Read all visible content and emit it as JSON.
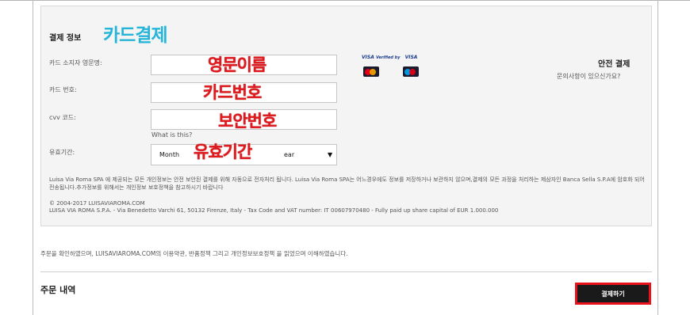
{
  "payment": {
    "section_title": "결제 정보",
    "overlay_title": "카드결제",
    "cardholder_label": "카드 소지자 영문명:",
    "cardholder_overlay": "영문이름",
    "card_number_label": "카드 번호:",
    "card_number_overlay": "카드번호",
    "cvv_label": "cvv 코드:",
    "cvv_overlay": "보안번호",
    "cvv_hint": "What is this?",
    "expiry_label": "유효기간:",
    "expiry_month": "Month",
    "expiry_year": "ear",
    "expiry_overlay": "유효기간",
    "visa_label": "VISA",
    "visa_verified": "Verified by",
    "secure_title": "안전 결제",
    "secure_sub": "문의사항이 있으신가요?",
    "privacy_text": "Luisa Via Roma SPA 에 제공되는 모든 개인정보는 안전 보안된 결제를 위해 자동으로 전자처리 됩니다. Luisa Via Roma SPA는 어느경우에도 정보를 저장하거나 보관하지 않으며,결제의 모든 과정을 처리하는 제삼자인 Banca Sella S.P.A에 암호화 되어 전송됩니다.추가정보를 위해서는 개인정보 보호정책을 참고하시기 바랍니다",
    "copyright": "© 2004-2017 LUISAVIAROMA.COM",
    "company": "LUISA VIA ROMA S.P.A. - Via Benedetto Varchi 61, 50132 Firenze, Italy - Tax Code and VAT number: IT 00607970480 - Fully paid up share capital of EUR 1.000.000"
  },
  "terms_text": "주문을 확인하였으며, LUISAVIAROMA.COM의 이용약관, 반품정책 그리고 개인정보보호정책 을 읽었으며 이해하였습니다.",
  "order": {
    "title": "주문 내역"
  },
  "pay_button": "결제하기",
  "colors": {
    "overlay_red": "#e0191e",
    "overlay_cyan": "#26b5d8",
    "button_border": "#e8121a"
  },
  "icons": {
    "dropdown": "chevron-down-icon",
    "mastercard": "mastercard-icon",
    "maestro": "maestro-icon",
    "visa": "visa-icon"
  }
}
